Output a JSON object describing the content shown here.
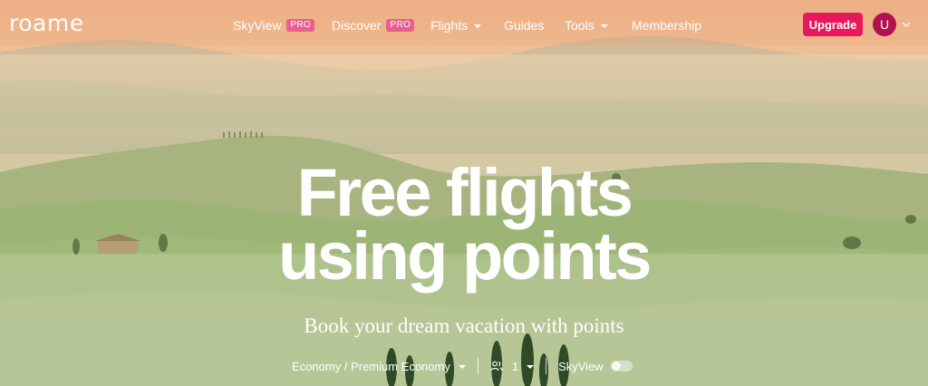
{
  "brand": {
    "logo_text": "roame"
  },
  "nav": {
    "skyview": {
      "label": "SkyView",
      "badge": "PRO"
    },
    "discover": {
      "label": "Discover",
      "badge": "PRO"
    },
    "flights": {
      "label": "Flights"
    },
    "guides": {
      "label": "Guides"
    },
    "tools": {
      "label": "Tools"
    },
    "membership": {
      "label": "Membership"
    },
    "upgrade_label": "Upgrade",
    "avatar_initial": "U"
  },
  "hero": {
    "title_line1": "Free flights",
    "title_line2": "using points",
    "subtitle": "Book your dream vacation with points"
  },
  "search": {
    "cabin_class": "Economy / Premium Economy",
    "passengers": "1",
    "skyview_label": "SkyView",
    "skyview_enabled": false
  },
  "colors": {
    "accent": "#e8185c",
    "pro_badge": "#e85f8e",
    "avatar": "#b0124f"
  }
}
